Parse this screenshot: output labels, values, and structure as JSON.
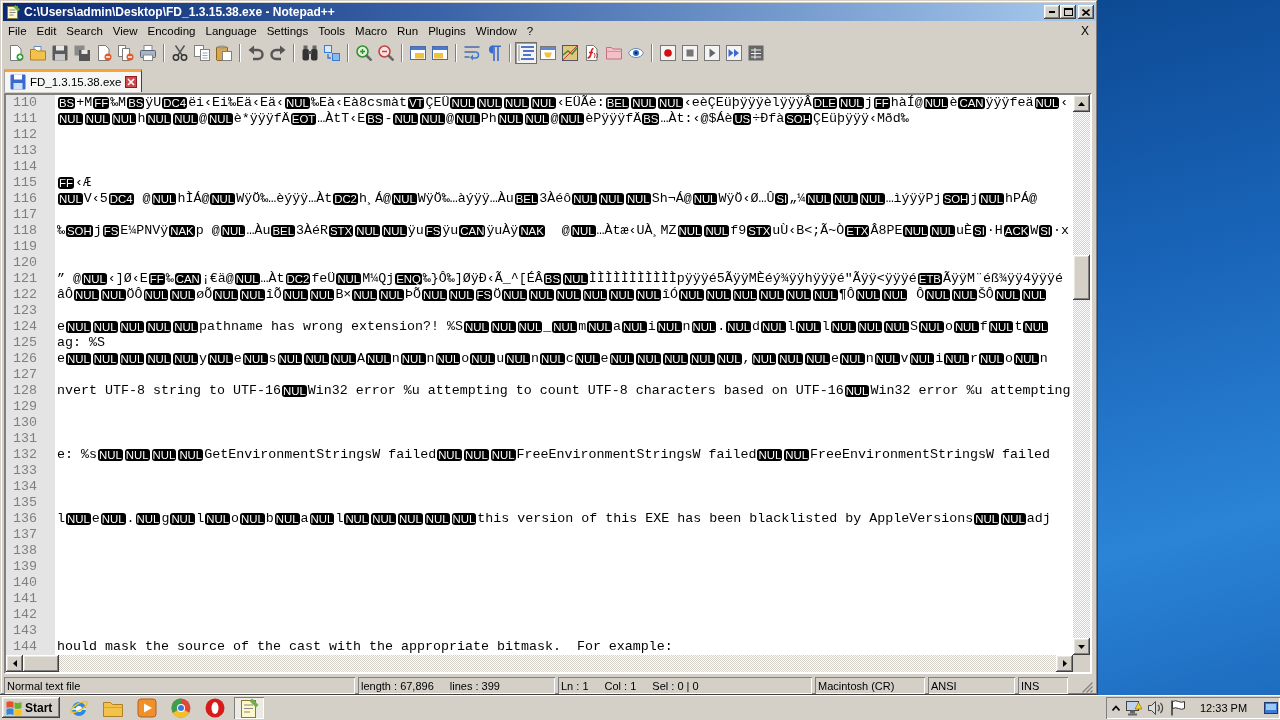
{
  "window": {
    "title": "C:\\Users\\admin\\Desktop\\FD_1.3.15.38.exe - Notepad++"
  },
  "menu": {
    "items": [
      "File",
      "Edit",
      "Search",
      "View",
      "Encoding",
      "Language",
      "Settings",
      "Tools",
      "Macro",
      "Run",
      "Plugins",
      "Window",
      "?"
    ],
    "close_document": "X"
  },
  "toolbar": {
    "groups": [
      {
        "buttons": [
          {
            "pressed": false
          },
          {
            "pressed": false
          },
          {
            "pressed": false
          },
          {
            "pressed": false
          },
          {
            "pressed": false
          },
          {
            "pressed": false
          },
          {
            "pressed": false
          }
        ]
      },
      {
        "buttons": [
          {
            "pressed": false
          },
          {
            "pressed": false
          },
          {
            "pressed": false
          }
        ]
      },
      {
        "buttons": [
          {
            "pressed": false
          },
          {
            "pressed": false
          }
        ]
      },
      {
        "buttons": [
          {
            "pressed": false
          },
          {
            "pressed": false
          }
        ]
      },
      {
        "buttons": [
          {
            "pressed": false
          },
          {
            "pressed": false
          }
        ]
      },
      {
        "buttons": [
          {
            "pressed": false
          },
          {
            "pressed": false
          }
        ]
      },
      {
        "buttons": [
          {
            "pressed": false
          },
          {
            "pressed": false
          }
        ]
      },
      {
        "buttons": [
          {
            "pressed": true
          },
          {
            "pressed": false
          },
          {
            "pressed": false
          },
          {
            "pressed": false
          },
          {
            "pressed": false
          },
          {
            "pressed": false
          }
        ]
      },
      {
        "buttons": [
          {
            "pressed": false
          },
          {
            "pressed": false
          },
          {
            "pressed": false
          },
          {
            "pressed": false
          },
          {
            "pressed": false
          }
        ]
      }
    ]
  },
  "tabs": [
    {
      "label": "FD_1.3.15.38.exe",
      "selected": true
    }
  ],
  "editor": {
    "lines": [
      {
        "number": "110",
        "segments": [
          {
            "kind": "ctrl",
            "text": "BS"
          },
          {
            "kind": "text",
            "text": "+M"
          },
          {
            "kind": "ctrl",
            "text": "FF"
          },
          {
            "kind": "text",
            "text": "‰M"
          },
          {
            "kind": "ctrl",
            "text": "BS"
          },
          {
            "kind": "text",
            "text": "ÿU"
          },
          {
            "kind": "ctrl",
            "text": "DC4"
          },
          {
            "kind": "text",
            "text": "ëi‹Ei‰Eä‹Eä‹"
          },
          {
            "kind": "ctrl",
            "text": "NUL"
          },
          {
            "kind": "text",
            "text": "‰Eà‹Eà8csmàt"
          },
          {
            "kind": "ctrl",
            "text": "VT"
          },
          {
            "kind": "text",
            "text": "ÇEÜ"
          },
          {
            "kind": "ctrl",
            "text": "NUL"
          },
          {
            "kind": "ctrl",
            "text": "NUL"
          },
          {
            "kind": "ctrl",
            "text": "NUL"
          },
          {
            "kind": "ctrl",
            "text": "NUL"
          },
          {
            "kind": "text",
            "text": "‹EÜÃè:"
          },
          {
            "kind": "ctrl",
            "text": "BEL"
          },
          {
            "kind": "ctrl",
            "text": "NUL"
          },
          {
            "kind": "ctrl",
            "text": "NUL"
          },
          {
            "kind": "text",
            "text": "‹eèÇEüþÿÿÿèlÿÿÿÂ"
          },
          {
            "kind": "ctrl",
            "text": "DLE"
          },
          {
            "kind": "ctrl",
            "text": "NUL"
          },
          {
            "kind": "text",
            "text": "j"
          },
          {
            "kind": "ctrl",
            "text": "FF"
          },
          {
            "kind": "text",
            "text": "hàÍ@"
          },
          {
            "kind": "ctrl",
            "text": "NUL"
          },
          {
            "kind": "text",
            "text": "è"
          },
          {
            "kind": "ctrl",
            "text": "CAN"
          },
          {
            "kind": "text",
            "text": "ÿÿÿfeä"
          },
          {
            "kind": "ctrl",
            "text": "NUL"
          },
          {
            "kind": "text",
            "text": "‹"
          }
        ]
      },
      {
        "number": "111",
        "segments": [
          {
            "kind": "ctrl",
            "text": "NUL"
          },
          {
            "kind": "ctrl",
            "text": "NUL"
          },
          {
            "kind": "ctrl",
            "text": "NUL"
          },
          {
            "kind": "text",
            "text": "h"
          },
          {
            "kind": "ctrl",
            "text": "NUL"
          },
          {
            "kind": "ctrl",
            "text": "NUL"
          },
          {
            "kind": "text",
            "text": "@"
          },
          {
            "kind": "ctrl",
            "text": "NUL"
          },
          {
            "kind": "text",
            "text": "è*ÿÿÿfÄ"
          },
          {
            "kind": "ctrl",
            "text": "EOT"
          },
          {
            "kind": "text",
            "text": "…ÀtT‹E"
          },
          {
            "kind": "ctrl",
            "text": "BS"
          },
          {
            "kind": "text",
            "text": "-"
          },
          {
            "kind": "ctrl",
            "text": "NUL"
          },
          {
            "kind": "ctrl",
            "text": "NUL"
          },
          {
            "kind": "text",
            "text": "@"
          },
          {
            "kind": "ctrl",
            "text": "NUL"
          },
          {
            "kind": "text",
            "text": "Ph"
          },
          {
            "kind": "ctrl",
            "text": "NUL"
          },
          {
            "kind": "ctrl",
            "text": "NUL"
          },
          {
            "kind": "text",
            "text": "@"
          },
          {
            "kind": "ctrl",
            "text": "NUL"
          },
          {
            "kind": "text",
            "text": "èPÿÿÿfÄ"
          },
          {
            "kind": "ctrl",
            "text": "BS"
          },
          {
            "kind": "text",
            "text": "…Àt:‹@$Áè"
          },
          {
            "kind": "ctrl",
            "text": "US"
          },
          {
            "kind": "text",
            "text": "÷Ðfà"
          },
          {
            "kind": "ctrl",
            "text": "SOH"
          },
          {
            "kind": "text",
            "text": "ÇEüþÿÿÿ‹Mðd‰"
          }
        ]
      },
      {
        "number": "112"
      },
      {
        "number": "113"
      },
      {
        "number": "114"
      },
      {
        "number": "115",
        "segments": [
          {
            "kind": "ctrl",
            "text": "FF"
          },
          {
            "kind": "text",
            "text": "‹Æ"
          }
        ]
      },
      {
        "number": "116",
        "segments": [
          {
            "kind": "ctrl",
            "text": "NUL"
          },
          {
            "kind": "text",
            "text": "V‹5"
          },
          {
            "kind": "ctrl",
            "text": "DC4"
          },
          {
            "kind": "text",
            "text": " @"
          },
          {
            "kind": "ctrl",
            "text": "NUL"
          },
          {
            "kind": "text",
            "text": "hÌÁ@"
          },
          {
            "kind": "ctrl",
            "text": "NUL"
          },
          {
            "kind": "text",
            "text": "WÿÖ‰…èýÿÿ…Àt"
          },
          {
            "kind": "ctrl",
            "text": "DC2"
          },
          {
            "kind": "text",
            "text": "h¸Á@"
          },
          {
            "kind": "ctrl",
            "text": "NUL"
          },
          {
            "kind": "text",
            "text": "WÿÖ‰…àýÿÿ…Àu"
          },
          {
            "kind": "ctrl",
            "text": "BEL"
          },
          {
            "kind": "text",
            "text": "3Àéô"
          },
          {
            "kind": "ctrl",
            "text": "NUL"
          },
          {
            "kind": "ctrl",
            "text": "NUL"
          },
          {
            "kind": "ctrl",
            "text": "NUL"
          },
          {
            "kind": "text",
            "text": "Sh¬Á@"
          },
          {
            "kind": "ctrl",
            "text": "NUL"
          },
          {
            "kind": "text",
            "text": "WÿÖ‹Ø…Û"
          },
          {
            "kind": "ctrl",
            "text": "SI"
          },
          {
            "kind": "text",
            "text": "„¼"
          },
          {
            "kind": "ctrl",
            "text": "NUL"
          },
          {
            "kind": "ctrl",
            "text": "NUL"
          },
          {
            "kind": "ctrl",
            "text": "NUL"
          },
          {
            "kind": "text",
            "text": "…ìýÿÿPj"
          },
          {
            "kind": "ctrl",
            "text": "SOH"
          },
          {
            "kind": "text",
            "text": "j"
          },
          {
            "kind": "ctrl",
            "text": "NUL"
          },
          {
            "kind": "text",
            "text": "hPÁ@"
          }
        ]
      },
      {
        "number": "117"
      },
      {
        "number": "118",
        "segments": [
          {
            "kind": "text",
            "text": "‰"
          },
          {
            "kind": "ctrl",
            "text": "SOH"
          },
          {
            "kind": "text",
            "text": "j"
          },
          {
            "kind": "ctrl",
            "text": "FS"
          },
          {
            "kind": "text",
            "text": "E¼PNVÿ"
          },
          {
            "kind": "ctrl",
            "text": "NAK"
          },
          {
            "kind": "text",
            "text": "p @"
          },
          {
            "kind": "ctrl",
            "text": "NUL"
          },
          {
            "kind": "text",
            "text": "…Àu"
          },
          {
            "kind": "ctrl",
            "text": "BEL"
          },
          {
            "kind": "text",
            "text": "3ÀéR"
          },
          {
            "kind": "ctrl",
            "text": "STX"
          },
          {
            "kind": "ctrl",
            "text": "NUL"
          },
          {
            "kind": "ctrl",
            "text": "NUL"
          },
          {
            "kind": "text",
            "text": "ÿu"
          },
          {
            "kind": "ctrl",
            "text": "FS"
          },
          {
            "kind": "text",
            "text": "ÿu"
          },
          {
            "kind": "ctrl",
            "text": "CAN"
          },
          {
            "kind": "text",
            "text": "ÿuÀÿ"
          },
          {
            "kind": "ctrl",
            "text": "NAK"
          },
          {
            "kind": "text",
            "text": "  @"
          },
          {
            "kind": "ctrl",
            "text": "NUL"
          },
          {
            "kind": "text",
            "text": "…Àtæ‹UÀ¸MZ"
          },
          {
            "kind": "ctrl",
            "text": "NUL"
          },
          {
            "kind": "ctrl",
            "text": "NUL"
          },
          {
            "kind": "text",
            "text": "f9"
          },
          {
            "kind": "ctrl",
            "text": "STX"
          },
          {
            "kind": "text",
            "text": "uÙ‹B<;Ã~Ò"
          },
          {
            "kind": "ctrl",
            "text": "ETX"
          },
          {
            "kind": "text",
            "text": "Â8PE"
          },
          {
            "kind": "ctrl",
            "text": "NUL"
          },
          {
            "kind": "ctrl",
            "text": "NUL"
          },
          {
            "kind": "text",
            "text": "uÈ"
          },
          {
            "kind": "ctrl",
            "text": "SI"
          },
          {
            "kind": "text",
            "text": "·H"
          },
          {
            "kind": "ctrl",
            "text": "ACK"
          },
          {
            "kind": "text",
            "text": "W"
          },
          {
            "kind": "ctrl",
            "text": "SI"
          },
          {
            "kind": "text",
            "text": "·x"
          }
        ]
      },
      {
        "number": "119"
      },
      {
        "number": "120"
      },
      {
        "number": "121",
        "segments": [
          {
            "kind": "text",
            "text": "” @"
          },
          {
            "kind": "ctrl",
            "text": "NUL"
          },
          {
            "kind": "text",
            "text": "‹]Ø‹E"
          },
          {
            "kind": "ctrl",
            "text": "FF"
          },
          {
            "kind": "text",
            "text": "‰"
          },
          {
            "kind": "ctrl",
            "text": "CAN"
          },
          {
            "kind": "text",
            "text": "¡€ä@"
          },
          {
            "kind": "ctrl",
            "text": "NUL"
          },
          {
            "kind": "text",
            "text": "…Àt"
          },
          {
            "kind": "ctrl",
            "text": "DC2"
          },
          {
            "kind": "text",
            "text": "feÜ"
          },
          {
            "kind": "ctrl",
            "text": "NUL"
          },
          {
            "kind": "text",
            "text": "M¼Qj"
          },
          {
            "kind": "ctrl",
            "text": "ENQ"
          },
          {
            "kind": "text",
            "text": "‰}Ô‰]ØÿÐ‹Ã_^[ÉÂ"
          },
          {
            "kind": "ctrl",
            "text": "BS"
          },
          {
            "kind": "ctrl",
            "text": "NUL"
          },
          {
            "kind": "text",
            "text": "ÌÌÌÌÌÌÌÌÌÌÌpÿÿÿé5ÃÿÿMÈéý¾ÿÿhÿÿÿé\"Ãÿÿ<ÿÿÿé"
          },
          {
            "kind": "ctrl",
            "text": "ETB"
          },
          {
            "kind": "text",
            "text": "ÃÿÿM¨éß¾ÿÿ4ÿÿÿé"
          }
        ]
      },
      {
        "number": "122",
        "segments": [
          {
            "kind": "text",
            "text": "âÔ"
          },
          {
            "kind": "ctrl",
            "text": "NUL"
          },
          {
            "kind": "ctrl",
            "text": "NUL"
          },
          {
            "kind": "text",
            "text": "ÖÔ"
          },
          {
            "kind": "ctrl",
            "text": "NUL"
          },
          {
            "kind": "ctrl",
            "text": "NUL"
          },
          {
            "kind": "text",
            "text": "øÕ"
          },
          {
            "kind": "ctrl",
            "text": "NUL"
          },
          {
            "kind": "ctrl",
            "text": "NUL"
          },
          {
            "kind": "text",
            "text": "îÕ"
          },
          {
            "kind": "ctrl",
            "text": "NUL"
          },
          {
            "kind": "ctrl",
            "text": "NUL"
          },
          {
            "kind": "text",
            "text": "B×"
          },
          {
            "kind": "ctrl",
            "text": "NUL"
          },
          {
            "kind": "ctrl",
            "text": "NUL"
          },
          {
            "kind": "text",
            "text": "ÞÕ"
          },
          {
            "kind": "ctrl",
            "text": "NUL"
          },
          {
            "kind": "ctrl",
            "text": "NUL"
          },
          {
            "kind": "ctrl",
            "text": "FS"
          },
          {
            "kind": "text",
            "text": "Ö"
          },
          {
            "kind": "ctrl",
            "text": "NUL"
          },
          {
            "kind": "ctrl",
            "text": "NUL"
          },
          {
            "kind": "ctrl",
            "text": "NUL"
          },
          {
            "kind": "ctrl",
            "text": "NUL"
          },
          {
            "kind": "ctrl",
            "text": "NUL"
          },
          {
            "kind": "ctrl",
            "text": "NUL"
          },
          {
            "kind": "text",
            "text": "îÓ"
          },
          {
            "kind": "ctrl",
            "text": "NUL"
          },
          {
            "kind": "ctrl",
            "text": "NUL"
          },
          {
            "kind": "ctrl",
            "text": "NUL"
          },
          {
            "kind": "ctrl",
            "text": "NUL"
          },
          {
            "kind": "ctrl",
            "text": "NUL"
          },
          {
            "kind": "ctrl",
            "text": "NUL"
          },
          {
            "kind": "text",
            "text": "¶Ô"
          },
          {
            "kind": "ctrl",
            "text": "NUL"
          },
          {
            "kind": "ctrl",
            "text": "NUL"
          },
          {
            "kind": "text",
            "text": " Ô"
          },
          {
            "kind": "ctrl",
            "text": "NUL"
          },
          {
            "kind": "ctrl",
            "text": "NUL"
          },
          {
            "kind": "text",
            "text": "ŠÔ"
          },
          {
            "kind": "ctrl",
            "text": "NUL"
          },
          {
            "kind": "ctrl",
            "text": "NUL"
          }
        ]
      },
      {
        "number": "123"
      },
      {
        "number": "124",
        "segments": [
          {
            "kind": "text",
            "text": "e"
          },
          {
            "kind": "ctrl",
            "text": "NUL"
          },
          {
            "kind": "ctrl",
            "text": "NUL"
          },
          {
            "kind": "ctrl",
            "text": "NUL"
          },
          {
            "kind": "ctrl",
            "text": "NUL"
          },
          {
            "kind": "ctrl",
            "text": "NUL"
          },
          {
            "kind": "text",
            "text": "pathname has wrong extension?! %S"
          },
          {
            "kind": "ctrl",
            "text": "NUL"
          },
          {
            "kind": "ctrl",
            "text": "NUL"
          },
          {
            "kind": "ctrl",
            "text": "NUL"
          },
          {
            "kind": "text",
            "text": "_"
          },
          {
            "kind": "ctrl",
            "text": "NUL"
          },
          {
            "kind": "text",
            "text": "m"
          },
          {
            "kind": "ctrl",
            "text": "NUL"
          },
          {
            "kind": "text",
            "text": "a"
          },
          {
            "kind": "ctrl",
            "text": "NUL"
          },
          {
            "kind": "text",
            "text": "i"
          },
          {
            "kind": "ctrl",
            "text": "NUL"
          },
          {
            "kind": "text",
            "text": "n"
          },
          {
            "kind": "ctrl",
            "text": "NUL"
          },
          {
            "kind": "text",
            "text": "."
          },
          {
            "kind": "ctrl",
            "text": "NUL"
          },
          {
            "kind": "text",
            "text": "d"
          },
          {
            "kind": "ctrl",
            "text": "NUL"
          },
          {
            "kind": "text",
            "text": "l"
          },
          {
            "kind": "ctrl",
            "text": "NUL"
          },
          {
            "kind": "text",
            "text": "l"
          },
          {
            "kind": "ctrl",
            "text": "NUL"
          },
          {
            "kind": "ctrl",
            "text": "NUL"
          },
          {
            "kind": "ctrl",
            "text": "NUL"
          },
          {
            "kind": "text",
            "text": "S"
          },
          {
            "kind": "ctrl",
            "text": "NUL"
          },
          {
            "kind": "text",
            "text": "o"
          },
          {
            "kind": "ctrl",
            "text": "NUL"
          },
          {
            "kind": "text",
            "text": "f"
          },
          {
            "kind": "ctrl",
            "text": "NUL"
          },
          {
            "kind": "text",
            "text": "t"
          },
          {
            "kind": "ctrl",
            "text": "NUL"
          }
        ]
      },
      {
        "number": "125",
        "segments": [
          {
            "kind": "text",
            "text": "ag: %S"
          }
        ]
      },
      {
        "number": "126",
        "segments": [
          {
            "kind": "text",
            "text": "e"
          },
          {
            "kind": "ctrl",
            "text": "NUL"
          },
          {
            "kind": "ctrl",
            "text": "NUL"
          },
          {
            "kind": "ctrl",
            "text": "NUL"
          },
          {
            "kind": "ctrl",
            "text": "NUL"
          },
          {
            "kind": "ctrl",
            "text": "NUL"
          },
          {
            "kind": "text",
            "text": "y"
          },
          {
            "kind": "ctrl",
            "text": "NUL"
          },
          {
            "kind": "text",
            "text": "e"
          },
          {
            "kind": "ctrl",
            "text": "NUL"
          },
          {
            "kind": "text",
            "text": "s"
          },
          {
            "kind": "ctrl",
            "text": "NUL"
          },
          {
            "kind": "ctrl",
            "text": "NUL"
          },
          {
            "kind": "ctrl",
            "text": "NUL"
          },
          {
            "kind": "text",
            "text": "A"
          },
          {
            "kind": "ctrl",
            "text": "NUL"
          },
          {
            "kind": "text",
            "text": "n"
          },
          {
            "kind": "ctrl",
            "text": "NUL"
          },
          {
            "kind": "text",
            "text": "n"
          },
          {
            "kind": "ctrl",
            "text": "NUL"
          },
          {
            "kind": "text",
            "text": "o"
          },
          {
            "kind": "ctrl",
            "text": "NUL"
          },
          {
            "kind": "text",
            "text": "u"
          },
          {
            "kind": "ctrl",
            "text": "NUL"
          },
          {
            "kind": "text",
            "text": "n"
          },
          {
            "kind": "ctrl",
            "text": "NUL"
          },
          {
            "kind": "text",
            "text": "c"
          },
          {
            "kind": "ctrl",
            "text": "NUL"
          },
          {
            "kind": "text",
            "text": "e"
          },
          {
            "kind": "ctrl",
            "text": "NUL"
          },
          {
            "kind": "ctrl",
            "text": "NUL"
          },
          {
            "kind": "ctrl",
            "text": "NUL"
          },
          {
            "kind": "ctrl",
            "text": "NUL"
          },
          {
            "kind": "ctrl",
            "text": "NUL"
          },
          {
            "kind": "text",
            "text": ","
          },
          {
            "kind": "ctrl",
            "text": "NUL"
          },
          {
            "kind": "ctrl",
            "text": "NUL"
          },
          {
            "kind": "ctrl",
            "text": "NUL"
          },
          {
            "kind": "text",
            "text": "e"
          },
          {
            "kind": "ctrl",
            "text": "NUL"
          },
          {
            "kind": "text",
            "text": "n"
          },
          {
            "kind": "ctrl",
            "text": "NUL"
          },
          {
            "kind": "text",
            "text": "v"
          },
          {
            "kind": "ctrl",
            "text": "NUL"
          },
          {
            "kind": "text",
            "text": "i"
          },
          {
            "kind": "ctrl",
            "text": "NUL"
          },
          {
            "kind": "text",
            "text": "r"
          },
          {
            "kind": "ctrl",
            "text": "NUL"
          },
          {
            "kind": "text",
            "text": "o"
          },
          {
            "kind": "ctrl",
            "text": "NUL"
          },
          {
            "kind": "text",
            "text": "n"
          }
        ]
      },
      {
        "number": "127"
      },
      {
        "number": "128",
        "segments": [
          {
            "kind": "text",
            "text": "nvert UTF-8 string to UTF-16"
          },
          {
            "kind": "ctrl",
            "text": "NUL"
          },
          {
            "kind": "text",
            "text": "Win32 error %u attempting to count UTF-8 characters based on UTF-16"
          },
          {
            "kind": "ctrl",
            "text": "NUL"
          },
          {
            "kind": "text",
            "text": "Win32 error %u attempting"
          }
        ]
      },
      {
        "number": "129"
      },
      {
        "number": "130"
      },
      {
        "number": "131"
      },
      {
        "number": "132",
        "segments": [
          {
            "kind": "text",
            "text": "e: %s"
          },
          {
            "kind": "ctrl",
            "text": "NUL"
          },
          {
            "kind": "ctrl",
            "text": "NUL"
          },
          {
            "kind": "ctrl",
            "text": "NUL"
          },
          {
            "kind": "ctrl",
            "text": "NUL"
          },
          {
            "kind": "text",
            "text": "GetEnvironmentStringsW failed"
          },
          {
            "kind": "ctrl",
            "text": "NUL"
          },
          {
            "kind": "ctrl",
            "text": "NUL"
          },
          {
            "kind": "ctrl",
            "text": "NUL"
          },
          {
            "kind": "text",
            "text": "FreeEnvironmentStringsW failed"
          },
          {
            "kind": "ctrl",
            "text": "NUL"
          },
          {
            "kind": "ctrl",
            "text": "NUL"
          },
          {
            "kind": "text",
            "text": "FreeEnvironmentStringsW failed"
          }
        ]
      },
      {
        "number": "133"
      },
      {
        "number": "134"
      },
      {
        "number": "135"
      },
      {
        "number": "136",
        "segments": [
          {
            "kind": "text",
            "text": "l"
          },
          {
            "kind": "ctrl",
            "text": "NUL"
          },
          {
            "kind": "text",
            "text": "e"
          },
          {
            "kind": "ctrl",
            "text": "NUL"
          },
          {
            "kind": "text",
            "text": "."
          },
          {
            "kind": "ctrl",
            "text": "NUL"
          },
          {
            "kind": "text",
            "text": "g"
          },
          {
            "kind": "ctrl",
            "text": "NUL"
          },
          {
            "kind": "text",
            "text": "l"
          },
          {
            "kind": "ctrl",
            "text": "NUL"
          },
          {
            "kind": "text",
            "text": "o"
          },
          {
            "kind": "ctrl",
            "text": "NUL"
          },
          {
            "kind": "text",
            "text": "b"
          },
          {
            "kind": "ctrl",
            "text": "NUL"
          },
          {
            "kind": "text",
            "text": "a"
          },
          {
            "kind": "ctrl",
            "text": "NUL"
          },
          {
            "kind": "text",
            "text": "l"
          },
          {
            "kind": "ctrl",
            "text": "NUL"
          },
          {
            "kind": "ctrl",
            "text": "NUL"
          },
          {
            "kind": "ctrl",
            "text": "NUL"
          },
          {
            "kind": "ctrl",
            "text": "NUL"
          },
          {
            "kind": "ctrl",
            "text": "NUL"
          },
          {
            "kind": "text",
            "text": "this version of this EXE has been blacklisted by AppleVersions"
          },
          {
            "kind": "ctrl",
            "text": "NUL"
          },
          {
            "kind": "ctrl",
            "text": "NUL"
          },
          {
            "kind": "text",
            "text": "adj"
          }
        ]
      },
      {
        "number": "137"
      },
      {
        "number": "138"
      },
      {
        "number": "139"
      },
      {
        "number": "140"
      },
      {
        "number": "141"
      },
      {
        "number": "142"
      },
      {
        "number": "143"
      },
      {
        "number": "144",
        "segments": [
          {
            "kind": "text",
            "text": "hould mask the source of the cast with the appropriate bitmask.  For example:"
          }
        ]
      }
    ]
  },
  "status_bar": {
    "sections": [
      {
        "items": [
          "Normal text file"
        ]
      },
      {
        "items": [
          "length : 67,896",
          "lines : 399"
        ]
      },
      {
        "items": [
          "Ln : 1",
          "Col : 1",
          "Sel : 0 | 0"
        ]
      },
      {
        "items": [
          "Macintosh (CR)"
        ]
      },
      {
        "items": [
          "ANSI"
        ]
      },
      {
        "items": [
          "INS"
        ]
      }
    ]
  },
  "taskbar": {
    "start": "Start",
    "apps": [
      {
        "selected": false
      },
      {
        "selected": false
      },
      {
        "selected": false
      },
      {
        "selected": false
      },
      {
        "selected": false
      },
      {
        "selected": true
      }
    ],
    "clock": "12:33 PM"
  }
}
